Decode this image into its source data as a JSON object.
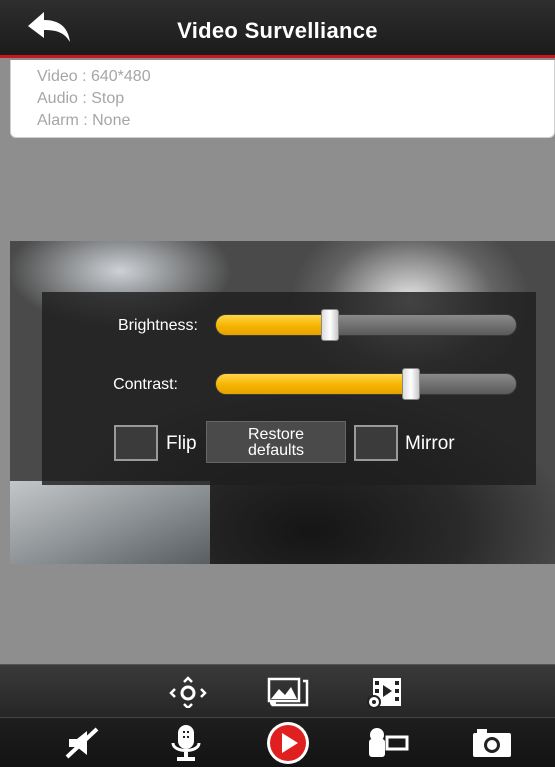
{
  "header": {
    "title": "Video Survelliance"
  },
  "info": {
    "video": "Video : 640*480",
    "audio": "Audio : Stop",
    "alarm": "Alarm : None"
  },
  "controls": {
    "brightness_label": "Brightness:",
    "brightness_level": 0.38,
    "contrast_label": "Contrast:",
    "contrast_level": 0.65,
    "flip_label": "Flip",
    "mirror_label": "Mirror",
    "restore_line1": "Restore",
    "restore_line2": "defaults"
  },
  "toolbar_top": [
    "ptz-icon",
    "image-settings-icon",
    "video-settings-icon"
  ],
  "toolbar_bottom": [
    "mute-icon",
    "microphone-icon",
    "play-icon",
    "record-icon",
    "snapshot-icon"
  ],
  "colors": {
    "accent": "#c8161d",
    "slider_fill": "#f5b400",
    "play": "#e02020"
  }
}
